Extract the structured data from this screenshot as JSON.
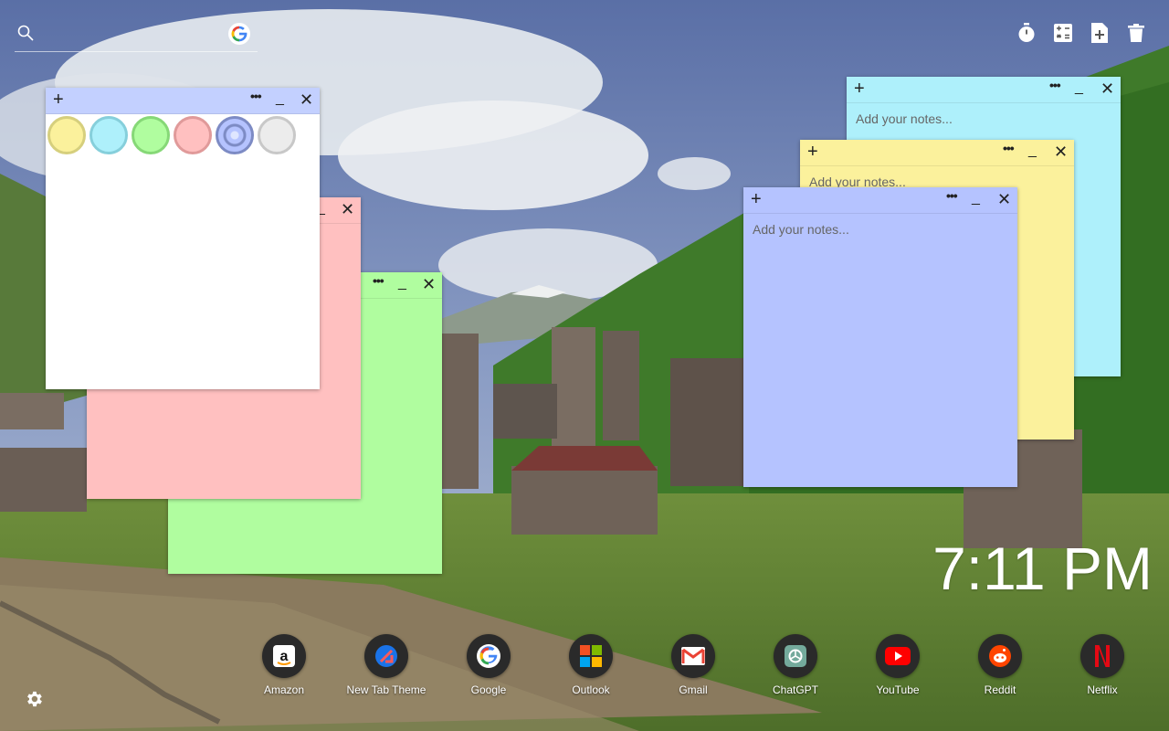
{
  "search": {
    "placeholder": "",
    "engine_icon": "google-g-icon"
  },
  "toolbar": {
    "icons": [
      "timer-icon",
      "calculator-icon",
      "new-note-icon",
      "trash-icon"
    ]
  },
  "notes": [
    {
      "color": "#aef0fb",
      "header_color": "#aef0fb",
      "placeholder": "Add your notes..."
    },
    {
      "color": "#fbf19c",
      "header_color": "#fbf19c",
      "placeholder": "Add your notes..."
    },
    {
      "color": "#b5c3ff",
      "header_color": "#b5c3ff",
      "placeholder": "Add your notes..."
    },
    {
      "color": "#b0fd9f",
      "header_color": "#b0fd9f",
      "placeholder": ""
    },
    {
      "color": "#ffc0c0",
      "header_color": "#ffc0c0",
      "placeholder": ""
    },
    {
      "color": "#ffffff",
      "header_color": "#c3d0ff",
      "placeholder": ""
    }
  ],
  "note_controls": {
    "add": "+",
    "more": "•••",
    "minimize": "_",
    "close": "✕"
  },
  "color_swatches": [
    {
      "name": "yellow",
      "fill": "#fbf19c",
      "ring": "#d6cf7d"
    },
    {
      "name": "cyan",
      "fill": "#aef0fb",
      "ring": "#86cfdb"
    },
    {
      "name": "green",
      "fill": "#b0fd9f",
      "ring": "#86d877"
    },
    {
      "name": "pink",
      "fill": "#ffc0c0",
      "ring": "#e09a9a"
    },
    {
      "name": "blue",
      "fill": "#b5c3ff",
      "ring": "#7d8bc4",
      "selected": true
    },
    {
      "name": "white",
      "fill": "#ececec",
      "ring": "#c8c8c8"
    }
  ],
  "clock": {
    "time": "7:11 PM"
  },
  "shortcuts": [
    {
      "label": "Amazon",
      "icon": "amazon-icon"
    },
    {
      "label": "New Tab Theme",
      "icon": "new-tab-theme-icon"
    },
    {
      "label": "Google",
      "icon": "google-icon"
    },
    {
      "label": "Outlook",
      "icon": "outlook-icon"
    },
    {
      "label": "Gmail",
      "icon": "gmail-icon"
    },
    {
      "label": "ChatGPT",
      "icon": "chatgpt-icon"
    },
    {
      "label": "YouTube",
      "icon": "youtube-icon"
    },
    {
      "label": "Reddit",
      "icon": "reddit-icon"
    },
    {
      "label": "Netflix",
      "icon": "netflix-icon"
    }
  ],
  "settings": {
    "icon": "gear-icon"
  }
}
